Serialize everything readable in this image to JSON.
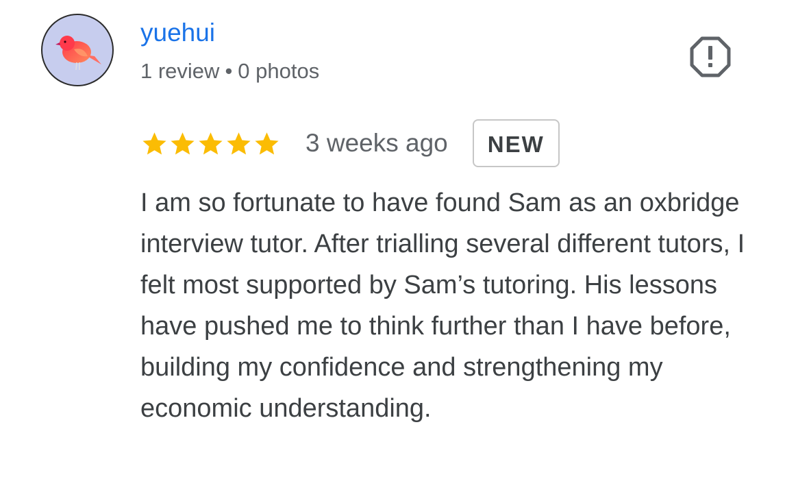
{
  "author": {
    "avatar_icon": "red-bird-avatar",
    "name": "yuehui",
    "review_count": "1 review",
    "separator": "•",
    "photo_count": "0 photos"
  },
  "report": {
    "icon": "report-flag-icon"
  },
  "review": {
    "rating": 5,
    "rating_max": 5,
    "time_ago": "3 weeks ago",
    "badge": "NEW",
    "text": "I am so fortunate to have found Sam as an oxbridge interview tutor. After trialling several different tutors, I felt most supported by Sam’s tutoring. His lessons have pushed me to think further than I have before, building my confidence and strengthening my economic understanding."
  },
  "colors": {
    "name_link": "#1a73e8",
    "star": "#fbbc04",
    "meta_text": "#5f6368",
    "body_text": "#3c4043",
    "avatar_bg": "#c7cdee"
  }
}
